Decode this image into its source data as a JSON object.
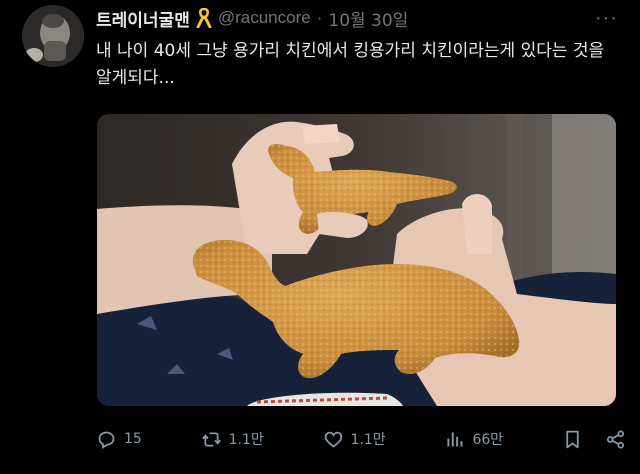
{
  "author": {
    "display_name": "트레이너굴맨",
    "handle": "@racuncore",
    "separator": "·",
    "date": "10월 30일",
    "badge_icon": "yellow-ribbon-icon",
    "badge_color": "#f0c33c"
  },
  "tweet": {
    "text": "내 나이 40세 그냥 용가리 치킨에서 킹용가리 치킨이라는게 있다는 것을 알게되다...",
    "media_icon": "dinosaur-shaped-chicken-nuggets-photo"
  },
  "menu": {
    "more_label": "···"
  },
  "actions": {
    "reply_count": "15",
    "retweet_count": "1.1만",
    "like_count": "1.1만",
    "view_count": "66만",
    "reply_icon": "reply-icon",
    "retweet_icon": "retweet-icon",
    "like_icon": "heart-icon",
    "view_icon": "views-icon",
    "bookmark_icon": "bookmark-icon",
    "share_icon": "share-icon"
  },
  "colors": {
    "background": "#000000",
    "text": "#e7e9ea",
    "secondary": "#71767b",
    "nugget": "#c98d3c"
  }
}
